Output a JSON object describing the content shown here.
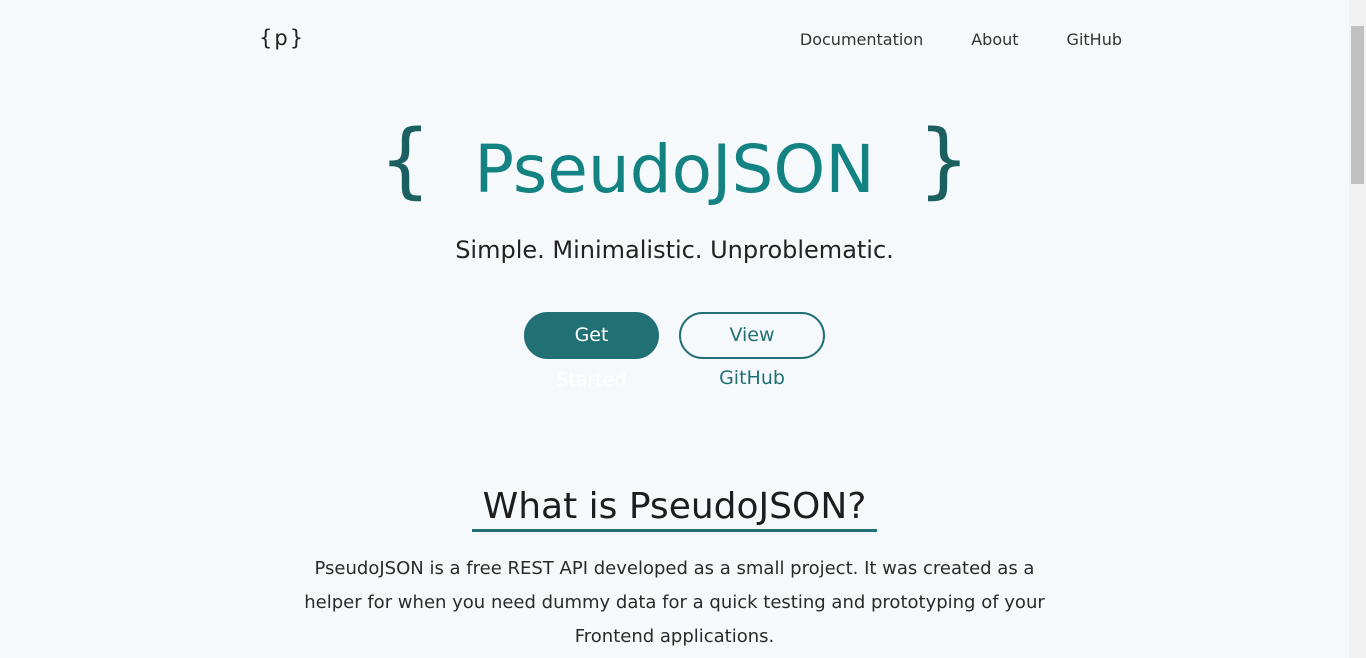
{
  "header": {
    "logo": "{p}",
    "nav": [
      "Documentation",
      "About",
      "GitHub"
    ]
  },
  "hero": {
    "brace_open": "{",
    "title": "PseudoJSON",
    "brace_close": "}",
    "tagline": "Simple. Minimalistic. Unproblematic.",
    "primary_button": "Get Started",
    "secondary_button": "View GitHub"
  },
  "about": {
    "heading": "What is PseudoJSON?",
    "description": "PseudoJSON is a free REST API developed as a small project. It was created as a helper for when you need dummy data for a quick testing and prototyping of your Frontend applications."
  },
  "colors": {
    "accent": "#128282",
    "button": "#217073",
    "background": "#f6f9fc"
  }
}
